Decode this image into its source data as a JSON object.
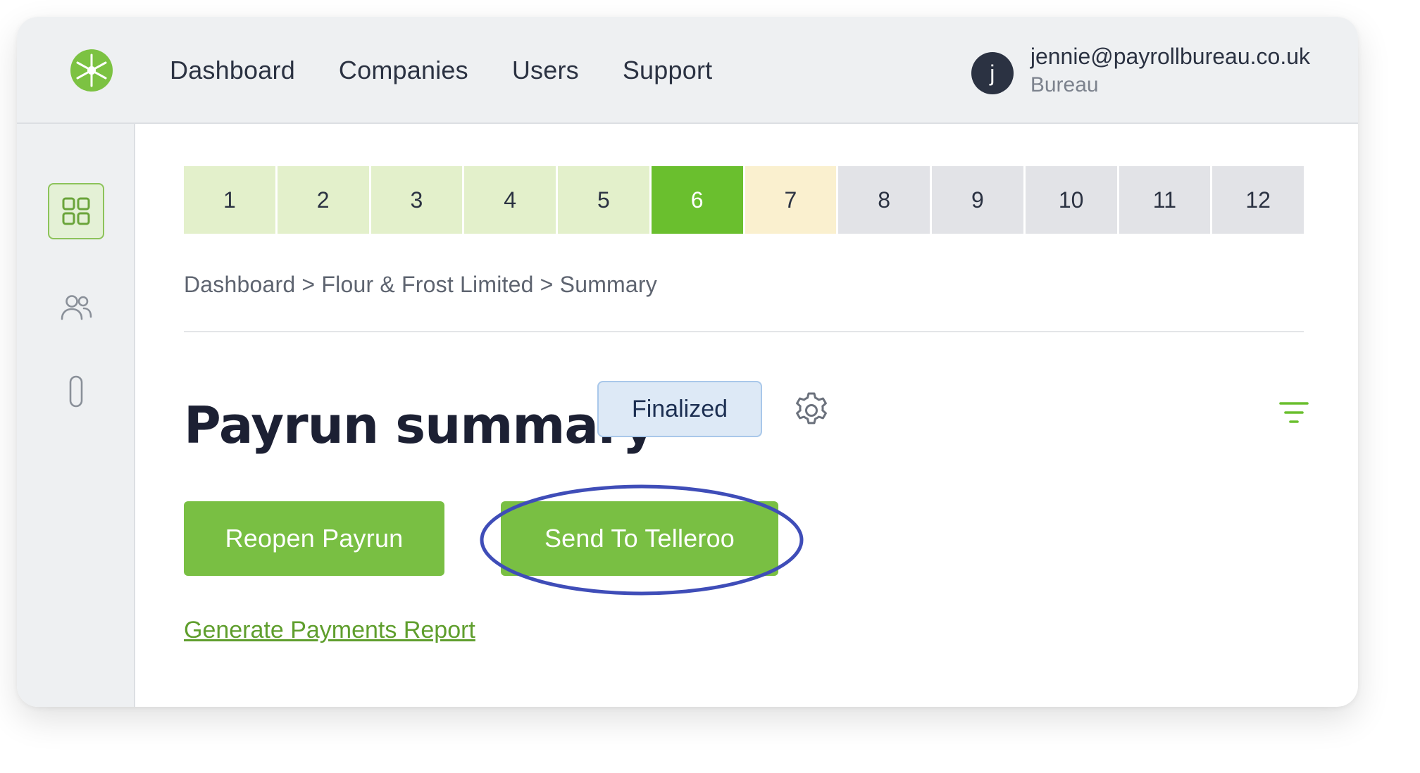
{
  "nav": {
    "items": [
      "Dashboard",
      "Companies",
      "Users",
      "Support"
    ]
  },
  "user": {
    "avatar_initial": "j",
    "email": "jennie@payrollbureau.co.uk",
    "role": "Bureau"
  },
  "sidebar": {
    "items": [
      {
        "icon": "dashboard-grid-icon",
        "active": true
      },
      {
        "icon": "users-icon",
        "active": false
      },
      {
        "icon": "paperclip-icon",
        "active": false
      }
    ]
  },
  "steps": [
    {
      "label": "1",
      "state": "done"
    },
    {
      "label": "2",
      "state": "done"
    },
    {
      "label": "3",
      "state": "done"
    },
    {
      "label": "4",
      "state": "done"
    },
    {
      "label": "5",
      "state": "done"
    },
    {
      "label": "6",
      "state": "current"
    },
    {
      "label": "7",
      "state": "next"
    },
    {
      "label": "8",
      "state": "future"
    },
    {
      "label": "9",
      "state": "future"
    },
    {
      "label": "10",
      "state": "future"
    },
    {
      "label": "11",
      "state": "future"
    },
    {
      "label": "12",
      "state": "future"
    }
  ],
  "breadcrumb": "Dashboard > Flour & Frost Limited > Summary",
  "page": {
    "title": "Payrun summary",
    "status": "Finalized"
  },
  "actions": {
    "reopen_label": "Reopen Payrun",
    "send_label": "Send To Telleroo",
    "report_link": "Generate Payments Report"
  },
  "colors": {
    "brand_green": "#79bf43",
    "step_current": "#6abf2e",
    "annotation_ring": "#3f4db8"
  }
}
